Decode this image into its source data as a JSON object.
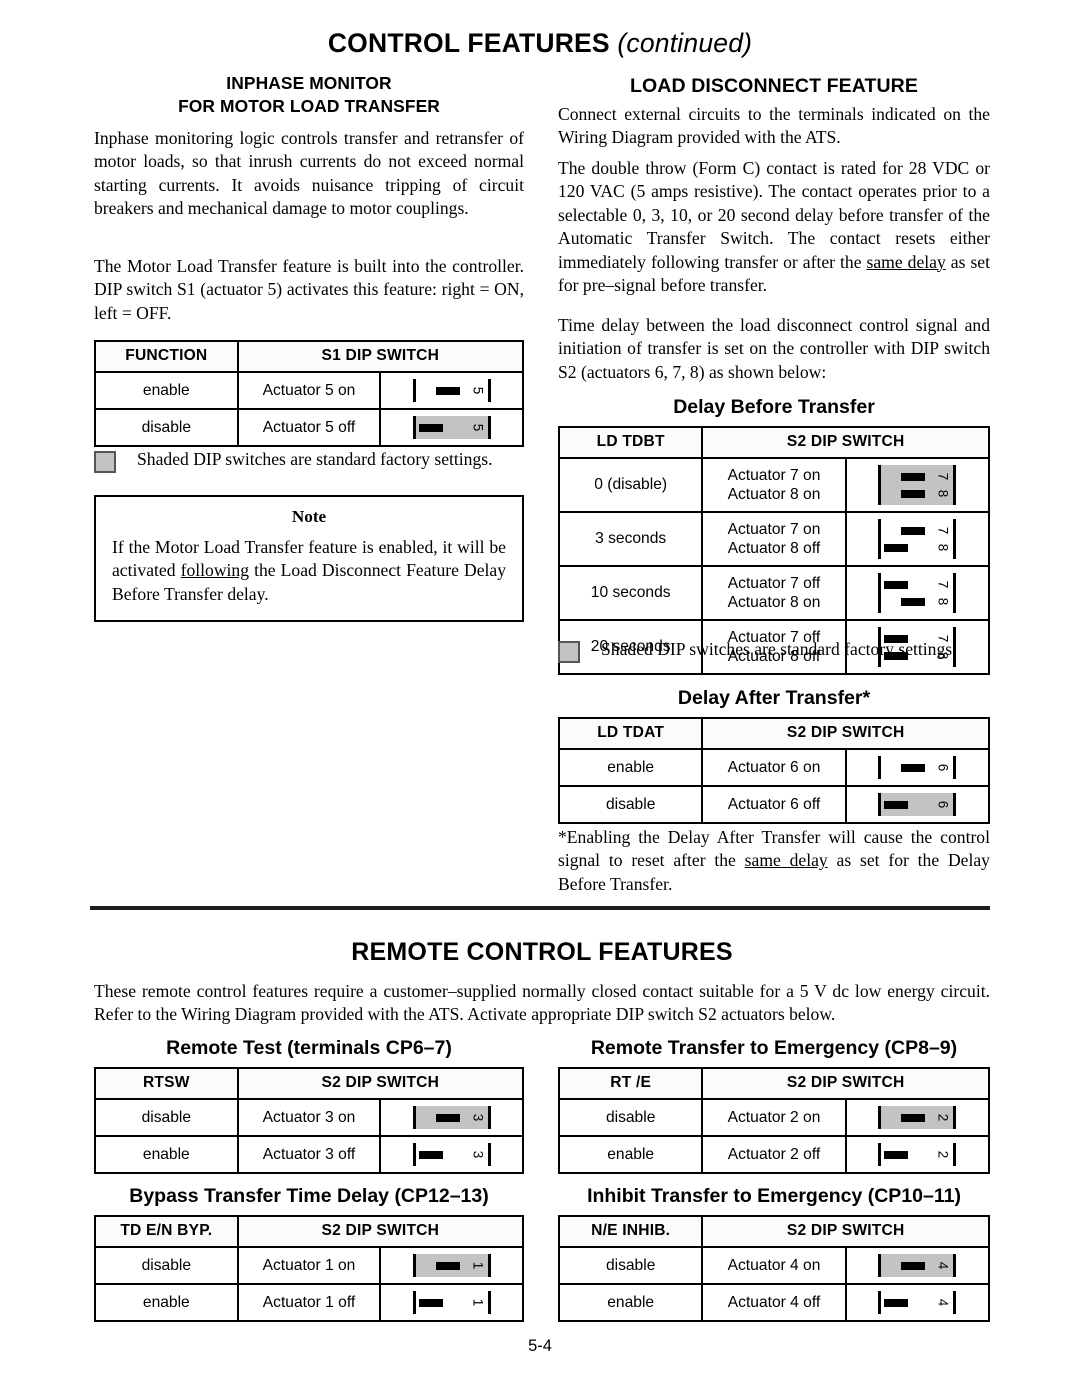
{
  "document": {
    "title_main": "CONTROL FEATURES",
    "title_continued": "(continued)",
    "page_number": "5-4",
    "shaded_gray": "#c3c3c3"
  },
  "left_column": {
    "heading_line1": "INPHASE MONITOR",
    "heading_line2": "FOR MOTOR LOAD TRANSFER",
    "para1": "Inphase monitoring logic controls transfer and retransfer of motor loads, so that inrush currents do not exceed normal starting currents. It avoids nuisance tripping of circuit breakers and mechanical damage to motor couplings.",
    "para2_a": "The Motor Load Transfer feature is built into the controller.  DIP switch S1 (actuator 5) activates this feature:  right = ON, left = OFF.",
    "legend": "Shaded DIP switches are standard factory settings.",
    "note": {
      "title": "Note",
      "text_a": "If the Motor Load Transfer feature is enabled, it will be activated ",
      "text_underlined": "following",
      "text_b": " the Load Disconnect Feature Delay Before Transfer delay."
    },
    "table_s1": {
      "headers": [
        "FUNCTION",
        "S1 DIP SWITCH"
      ],
      "rows": [
        {
          "function": "enable",
          "actuators": [
            "Actuator 5 on"
          ],
          "shaded": false,
          "switches": [
            {
              "num": "5",
              "state": "on"
            }
          ]
        },
        {
          "function": "disable",
          "actuators": [
            "Actuator 5 off"
          ],
          "shaded": true,
          "switches": [
            {
              "num": "5",
              "state": "off"
            }
          ]
        }
      ]
    }
  },
  "right_column": {
    "heading": "LOAD DISCONNECT FEATURE",
    "para1": "Connect external circuits to the terminals indicated on the Wiring Diagram provided with the ATS.",
    "para2_a": "The double throw (Form C) contact is rated for 28 VDC or 120 VAC (5 amps resistive).  The contact operates prior to a selectable 0, 3, 10, or 20 second delay before transfer of the Automatic Transfer Switch.  The contact resets either immediately following transfer or after the ",
    "para2_underlined": "same delay",
    "para2_b": " as set for pre–signal before transfer.",
    "para3": "Time delay between the load disconnect control signal and initiation of transfer is set on the controller with DIP switch S2 (actuators 6, 7, 8) as shown below:",
    "legend": "Shaded DIP switches are standard factory settings.",
    "footnote_a": "*Enabling the Delay After Transfer will cause the control signal to reset after the ",
    "footnote_underlined": "same delay",
    "footnote_b": " as set for the Delay Before Transfer.",
    "table_tdbt": {
      "title": "Delay Before Transfer",
      "headers": [
        "LD TDBT",
        "S2 DIP SWITCH"
      ],
      "rows": [
        {
          "function": "0 (disable)",
          "actuators": [
            "Actuator 7 on",
            "Actuator 8 on"
          ],
          "shaded": true,
          "switches": [
            {
              "num": "7",
              "state": "on"
            },
            {
              "num": "8",
              "state": "on"
            }
          ]
        },
        {
          "function": "3 seconds",
          "actuators": [
            "Actuator 7 on",
            "Actuator 8 off"
          ],
          "shaded": false,
          "switches": [
            {
              "num": "7",
              "state": "on"
            },
            {
              "num": "8",
              "state": "off"
            }
          ]
        },
        {
          "function": "10 seconds",
          "actuators": [
            "Actuator 7 off",
            "Actuator 8 on"
          ],
          "shaded": false,
          "switches": [
            {
              "num": "7",
              "state": "off"
            },
            {
              "num": "8",
              "state": "on"
            }
          ]
        },
        {
          "function": "20 seconds",
          "actuators": [
            "Actuator 7 off",
            "Actuator 8 off"
          ],
          "shaded": false,
          "switches": [
            {
              "num": "7",
              "state": "off"
            },
            {
              "num": "8",
              "state": "off"
            }
          ]
        }
      ]
    },
    "table_tdat": {
      "title": "Delay After Transfer*",
      "headers": [
        "LD TDAT",
        "S2 DIP SWITCH"
      ],
      "rows": [
        {
          "function": "enable",
          "actuators": [
            "Actuator 6 on"
          ],
          "shaded": false,
          "switches": [
            {
              "num": "6",
              "state": "on"
            }
          ]
        },
        {
          "function": "disable",
          "actuators": [
            "Actuator 6 off"
          ],
          "shaded": true,
          "switches": [
            {
              "num": "6",
              "state": "off"
            }
          ]
        }
      ]
    }
  },
  "remote_section": {
    "heading": "REMOTE CONTROL FEATURES",
    "intro": "These remote control features require a customer–supplied normally closed contact suitable for a 5 V dc low energy circuit.  Refer to the Wiring Diagram provided with the ATS.  Activate appropriate DIP switch S2 actuators below.",
    "tables": [
      {
        "title": "Remote Test (terminals CP6–7)",
        "headers": [
          "RTSW",
          "S2 DIP SWITCH"
        ],
        "rows": [
          {
            "function": "disable",
            "actuators": [
              "Actuator 3 on"
            ],
            "shaded": true,
            "switches": [
              {
                "num": "3",
                "state": "on"
              }
            ]
          },
          {
            "function": "enable",
            "actuators": [
              "Actuator 3 off"
            ],
            "shaded": false,
            "switches": [
              {
                "num": "3",
                "state": "off"
              }
            ]
          }
        ]
      },
      {
        "title": "Remote Transfer to Emergency (CP8–9)",
        "headers": [
          "RT /E",
          "S2 DIP SWITCH"
        ],
        "rows": [
          {
            "function": "disable",
            "actuators": [
              "Actuator 2 on"
            ],
            "shaded": true,
            "switches": [
              {
                "num": "2",
                "state": "on"
              }
            ]
          },
          {
            "function": "enable",
            "actuators": [
              "Actuator 2 off"
            ],
            "shaded": false,
            "switches": [
              {
                "num": "2",
                "state": "off"
              }
            ]
          }
        ]
      },
      {
        "title": "Bypass Transfer Time Delay (CP12–13)",
        "headers": [
          "TD E/N BYP.",
          "S2 DIP SWITCH"
        ],
        "rows": [
          {
            "function": "disable",
            "actuators": [
              "Actuator 1 on"
            ],
            "shaded": true,
            "switches": [
              {
                "num": "1",
                "state": "on"
              }
            ]
          },
          {
            "function": "enable",
            "actuators": [
              "Actuator 1 off"
            ],
            "shaded": false,
            "switches": [
              {
                "num": "1",
                "state": "off"
              }
            ]
          }
        ]
      },
      {
        "title": "Inhibit Transfer to Emergency (CP10–11)",
        "headers": [
          "N/E INHIB.",
          "S2 DIP SWITCH"
        ],
        "rows": [
          {
            "function": "disable",
            "actuators": [
              "Actuator 4 on"
            ],
            "shaded": true,
            "switches": [
              {
                "num": "4",
                "state": "on"
              }
            ]
          },
          {
            "function": "enable",
            "actuators": [
              "Actuator 4 off"
            ],
            "shaded": false,
            "switches": [
              {
                "num": "4",
                "state": "off"
              }
            ]
          }
        ]
      }
    ]
  }
}
